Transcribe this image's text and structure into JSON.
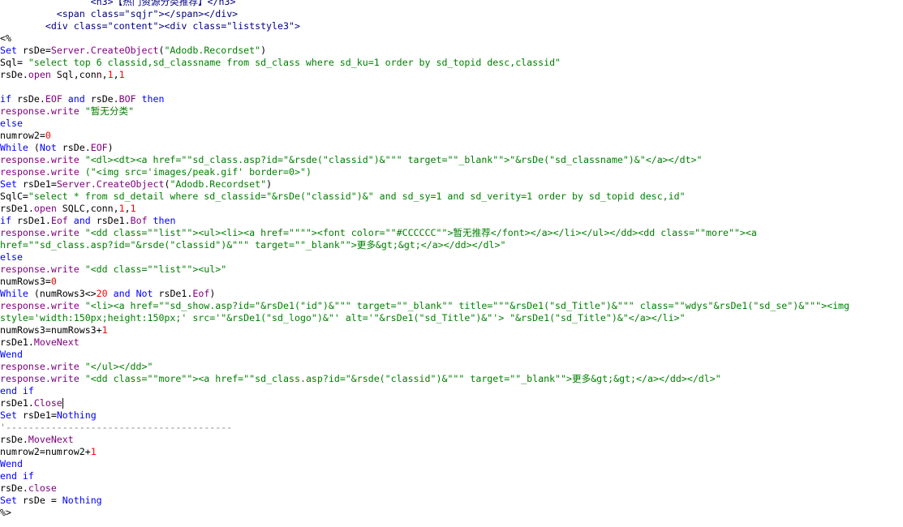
{
  "colors": {
    "background": "#ffffff",
    "keyword": "#0000ff",
    "function": "#800080",
    "string": "#008000",
    "number": "#ff0000",
    "html_tag": "#000080",
    "comment": "#808080",
    "text": "#000000"
  },
  "editor": {
    "lines": [
      [
        {
          "t": "tag",
          "v": "                <h3>【热门资源分类推荐】</h3>"
        }
      ],
      [
        {
          "t": "tag",
          "v": "          <span class=\"sqjr\"></span></div>"
        }
      ],
      [
        {
          "t": "tag",
          "v": "        <div class=\"content\"><div class=\"liststyle3\">"
        }
      ],
      [
        {
          "t": "txt",
          "v": "<%"
        }
      ],
      [
        {
          "t": "kw",
          "v": "Set"
        },
        {
          "t": "txt",
          "v": " rsDe="
        },
        {
          "t": "fn",
          "v": "Server.CreateObject"
        },
        {
          "t": "txt",
          "v": "("
        },
        {
          "t": "str",
          "v": "\"Adodb.Recordset\""
        },
        {
          "t": "txt",
          "v": ")"
        }
      ],
      [
        {
          "t": "txt",
          "v": "Sql= "
        },
        {
          "t": "str",
          "v": "\"select top 6 classid,sd_classname from sd_class where sd_ku=1 order by sd_topid desc,classid\""
        }
      ],
      [
        {
          "t": "txt",
          "v": "rsDe."
        },
        {
          "t": "fn",
          "v": "open"
        },
        {
          "t": "txt",
          "v": " Sql,conn,"
        },
        {
          "t": "num",
          "v": "1"
        },
        {
          "t": "txt",
          "v": ","
        },
        {
          "t": "num",
          "v": "1"
        }
      ],
      [
        {
          "t": "txt",
          "v": ""
        }
      ],
      [
        {
          "t": "kw",
          "v": "if"
        },
        {
          "t": "txt",
          "v": " rsDe."
        },
        {
          "t": "fn",
          "v": "EOF"
        },
        {
          "t": "txt",
          "v": " "
        },
        {
          "t": "kw",
          "v": "and"
        },
        {
          "t": "txt",
          "v": " rsDe."
        },
        {
          "t": "fn",
          "v": "BOF"
        },
        {
          "t": "txt",
          "v": " "
        },
        {
          "t": "kw",
          "v": "then"
        }
      ],
      [
        {
          "t": "fn",
          "v": "response.write"
        },
        {
          "t": "txt",
          "v": " "
        },
        {
          "t": "str",
          "v": "\"暂无分类\""
        }
      ],
      [
        {
          "t": "kw",
          "v": "else"
        }
      ],
      [
        {
          "t": "txt",
          "v": "numrow2="
        },
        {
          "t": "num",
          "v": "0"
        }
      ],
      [
        {
          "t": "kw",
          "v": "While"
        },
        {
          "t": "txt",
          "v": " ("
        },
        {
          "t": "kw",
          "v": "Not"
        },
        {
          "t": "txt",
          "v": " rsDe."
        },
        {
          "t": "fn",
          "v": "EOF"
        },
        {
          "t": "txt",
          "v": ")"
        }
      ],
      [
        {
          "t": "fn",
          "v": "response.write"
        },
        {
          "t": "txt",
          "v": " "
        },
        {
          "t": "str",
          "v": "\"<dl><dt><a href=\"\"sd_class.asp?id=\"&rsde(\"classid\")&\"\"\" target=\"\"_blank\"\">\"&rsDe(\"sd_classname\")&\"</a></dt>\""
        }
      ],
      [
        {
          "t": "fn",
          "v": "response.write"
        },
        {
          "t": "txt",
          "v": " "
        },
        {
          "t": "str",
          "v": "(\"<img src='images/peak.gif' border=0>\")"
        }
      ],
      [
        {
          "t": "kw",
          "v": "Set"
        },
        {
          "t": "txt",
          "v": " rsDe1="
        },
        {
          "t": "fn",
          "v": "Server.CreateObject"
        },
        {
          "t": "txt",
          "v": "("
        },
        {
          "t": "str",
          "v": "\"Adodb.Recordset\""
        },
        {
          "t": "txt",
          "v": ")"
        }
      ],
      [
        {
          "t": "txt",
          "v": "SqlC="
        },
        {
          "t": "str",
          "v": "\"select * from sd_detail where sd_classid=\"&rsDe(\"classid\")&\" and sd_sy=1 and sd_verity=1 order by sd_topid desc,id\""
        }
      ],
      [
        {
          "t": "txt",
          "v": "rsDe1."
        },
        {
          "t": "fn",
          "v": "open"
        },
        {
          "t": "txt",
          "v": " SQLC,conn,"
        },
        {
          "t": "num",
          "v": "1"
        },
        {
          "t": "txt",
          "v": ","
        },
        {
          "t": "num",
          "v": "1"
        }
      ],
      [
        {
          "t": "kw",
          "v": "if"
        },
        {
          "t": "txt",
          "v": " rsDe1."
        },
        {
          "t": "fn",
          "v": "Eof"
        },
        {
          "t": "txt",
          "v": " "
        },
        {
          "t": "kw",
          "v": "and"
        },
        {
          "t": "txt",
          "v": " rsDe1."
        },
        {
          "t": "fn",
          "v": "Bof"
        },
        {
          "t": "txt",
          "v": " "
        },
        {
          "t": "kw",
          "v": "then"
        }
      ],
      [
        {
          "t": "fn",
          "v": "response.write"
        },
        {
          "t": "txt",
          "v": " "
        },
        {
          "t": "str",
          "v": "\"<dd class=\"\"list\"\"><ul><li><a href=\"\"\"\"><font color=\"\"#CCCCCC\"\">暂无推荐</font></a></li></ul></dd><dd class=\"\"more\"\"><a"
        }
      ],
      [
        {
          "t": "str",
          "v": "href=\"\"sd_class.asp?id=\"&rsde(\"classid\")&\"\"\" target=\"\"_blank\"\">更多&gt;&gt;</a></dd></dl>\""
        }
      ],
      [
        {
          "t": "kw",
          "v": "else"
        }
      ],
      [
        {
          "t": "fn",
          "v": "response.write"
        },
        {
          "t": "txt",
          "v": " "
        },
        {
          "t": "str",
          "v": "\"<dd class=\"\"list\"\"><ul>\""
        }
      ],
      [
        {
          "t": "txt",
          "v": "numRows3="
        },
        {
          "t": "num",
          "v": "0"
        }
      ],
      [
        {
          "t": "kw",
          "v": "While"
        },
        {
          "t": "txt",
          "v": " (numRows3<>"
        },
        {
          "t": "num",
          "v": "20"
        },
        {
          "t": "txt",
          "v": " "
        },
        {
          "t": "kw",
          "v": "and"
        },
        {
          "t": "txt",
          "v": " "
        },
        {
          "t": "kw",
          "v": "Not"
        },
        {
          "t": "txt",
          "v": " rsDe1."
        },
        {
          "t": "fn",
          "v": "Eof"
        },
        {
          "t": "txt",
          "v": ")"
        }
      ],
      [
        {
          "t": "fn",
          "v": "response.write"
        },
        {
          "t": "txt",
          "v": " "
        },
        {
          "t": "str",
          "v": "\"<li><a href=\"\"sd_show.asp?id=\"&rsDe1(\"id\")&\"\"\" target=\"\"_blank\"\" title=\"\"\"&rsDe1(\"sd_Title\")&\"\"\" class=\"\"wdys\"&rsDe1(\"sd_se\")&\"\"\"><img"
        }
      ],
      [
        {
          "t": "str",
          "v": "style='width:150px;height:150px;' src='\"&rsDe1(\"sd_logo\")&\"' alt='\"&rsDe1(\"sd_Title\")&\"'> \"&rsDe1(\"sd_Title\")&\"</a></li>\""
        }
      ],
      [
        {
          "t": "txt",
          "v": "numRows3=numRows3+"
        },
        {
          "t": "num",
          "v": "1"
        }
      ],
      [
        {
          "t": "txt",
          "v": "rsDe1."
        },
        {
          "t": "fn",
          "v": "MoveNext"
        }
      ],
      [
        {
          "t": "kw",
          "v": "Wend"
        }
      ],
      [
        {
          "t": "fn",
          "v": "response.write"
        },
        {
          "t": "txt",
          "v": " "
        },
        {
          "t": "str",
          "v": "\"</ul></dd>\""
        }
      ],
      [
        {
          "t": "fn",
          "v": "response.write"
        },
        {
          "t": "txt",
          "v": " "
        },
        {
          "t": "str",
          "v": "\"<dd class=\"\"more\"\"><a href=\"\"sd_class.asp?id=\"&rsde(\"classid\")&\"\"\" target=\"\"_blank\"\">更多&gt;&gt;</a></dd></dl>\""
        }
      ],
      [
        {
          "t": "kw",
          "v": "end if"
        }
      ],
      [
        {
          "t": "txt",
          "v": "rsDe1."
        },
        {
          "t": "fn",
          "v": "Close"
        },
        {
          "t": "caret",
          "v": ""
        }
      ],
      [
        {
          "t": "kw",
          "v": "Set"
        },
        {
          "t": "txt",
          "v": " rsDe1="
        },
        {
          "t": "kw",
          "v": "Nothing"
        }
      ],
      [
        {
          "t": "cmt",
          "v": "'----------------------------------------"
        }
      ],
      [
        {
          "t": "txt",
          "v": "rsDe."
        },
        {
          "t": "fn",
          "v": "MoveNext"
        }
      ],
      [
        {
          "t": "txt",
          "v": "numrow2=numrow2+"
        },
        {
          "t": "num",
          "v": "1"
        }
      ],
      [
        {
          "t": "kw",
          "v": "Wend"
        }
      ],
      [
        {
          "t": "kw",
          "v": "end if"
        }
      ],
      [
        {
          "t": "txt",
          "v": "rsDe."
        },
        {
          "t": "fn",
          "v": "close"
        }
      ],
      [
        {
          "t": "kw",
          "v": "Set"
        },
        {
          "t": "txt",
          "v": " rsDe = "
        },
        {
          "t": "kw",
          "v": "Nothing"
        }
      ],
      [
        {
          "t": "txt",
          "v": "%>"
        }
      ]
    ]
  }
}
